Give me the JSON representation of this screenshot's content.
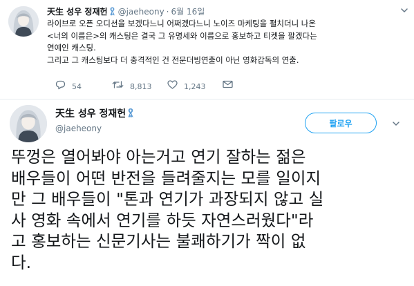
{
  "tweet1": {
    "avatar": "avatar",
    "name": "天生 성우 정재헌",
    "ribbon_icon": "blue-ribbon-icon",
    "handle": "@jaeheony",
    "separator": "·",
    "time": "6월 16일",
    "body_lines": [
      "라이브로 오픈 오디션을 보겠다느니 어쩌겠다느니 노이즈 마케팅을 펼치더니 나온",
      "<너의 이름은>의 캐스팅은 결국 그 유명세와 이름으로 홍보하고 티켓을 팔겠다는",
      "연예인 캐스팅.",
      "그리고 그 캐스팅보다 더 충격적인 건 전문더빙연출이 아닌 영화감독의 연출."
    ],
    "actions": {
      "reply_count": "54",
      "retweet_count": "8,813",
      "like_count": "1,243"
    }
  },
  "tweet2": {
    "avatar": "avatar",
    "name": "天生 성우 정재헌",
    "ribbon_icon": "blue-ribbon-icon",
    "handle": "@jaeheony",
    "follow_label": "팔로우",
    "body_lines": [
      "뚜껑은 열어봐야 아는거고 연기 잘하는 젊은",
      "배우들이 어떤 반전을 들려줄지는 모를 일이지",
      "만 그 배우들이 \"톤과 연기가 과장되지 않고 실",
      "사 영화 속에서 연기를 하듯 자연스러웠다\"라",
      "고 홍보하는 신문기사는 불쾌하기가 짝이 없",
      "다."
    ]
  },
  "colors": {
    "accent": "#1da1f2",
    "muted": "#657786",
    "text": "#14171a",
    "ribbon": "#5b9bd5"
  }
}
